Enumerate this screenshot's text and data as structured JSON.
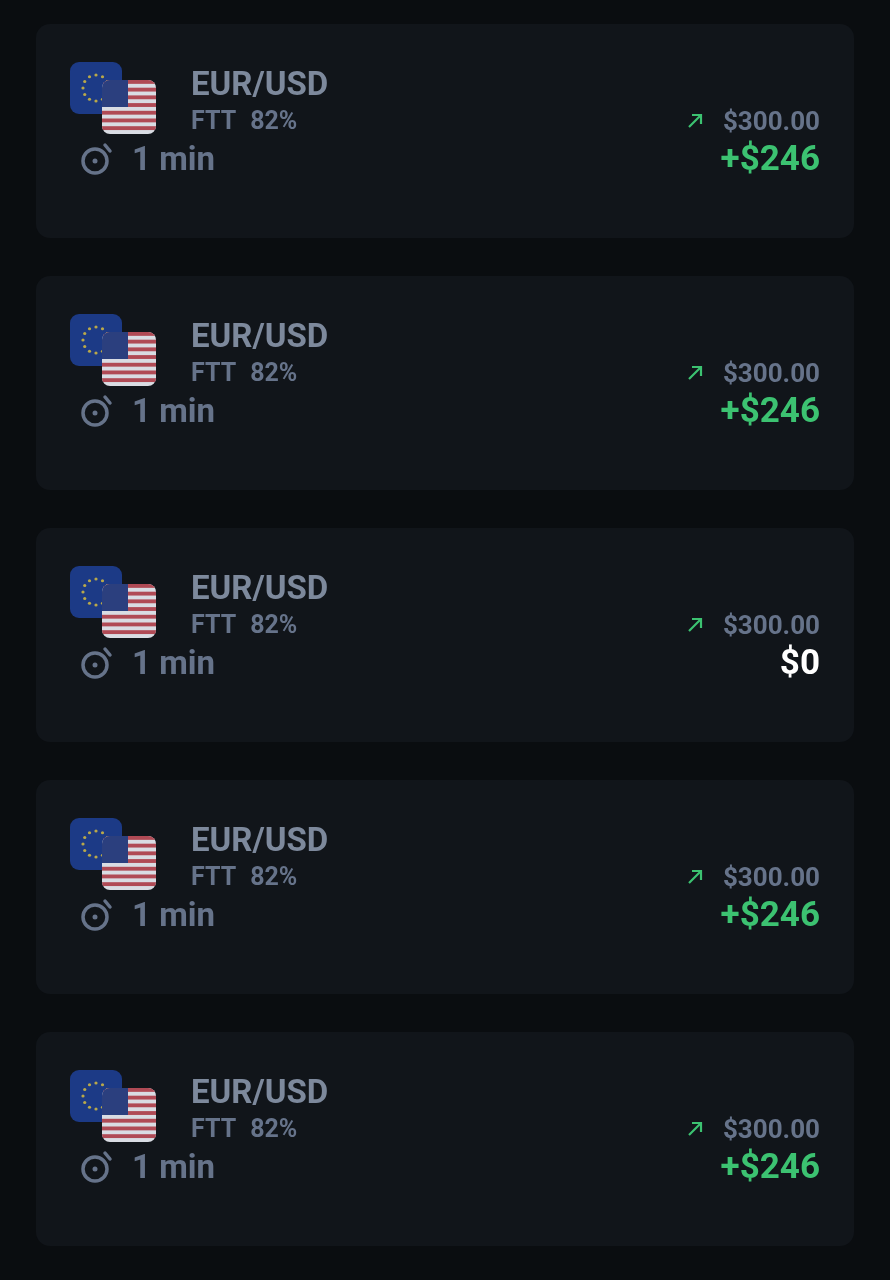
{
  "trades": [
    {
      "pair": "EUR/USD",
      "type": "FTT",
      "payout": "82%",
      "rising": true,
      "amount": "$300.00",
      "duration": "1 min",
      "result": "+$246",
      "profit": true
    },
    {
      "pair": "EUR/USD",
      "type": "FTT",
      "payout": "82%",
      "rising": true,
      "amount": "$300.00",
      "duration": "1 min",
      "result": "+$246",
      "profit": true
    },
    {
      "pair": "EUR/USD",
      "type": "FTT",
      "payout": "82%",
      "rising": true,
      "amount": "$300.00",
      "duration": "1 min",
      "result": "$0",
      "profit": false
    },
    {
      "pair": "EUR/USD",
      "type": "FTT",
      "payout": "82%",
      "rising": true,
      "amount": "$300.00",
      "duration": "1 min",
      "result": "+$246",
      "profit": true
    },
    {
      "pair": "EUR/USD",
      "type": "FTT",
      "payout": "82%",
      "rising": true,
      "amount": "$300.00",
      "duration": "1 min",
      "result": "+$246",
      "profit": true
    }
  ]
}
